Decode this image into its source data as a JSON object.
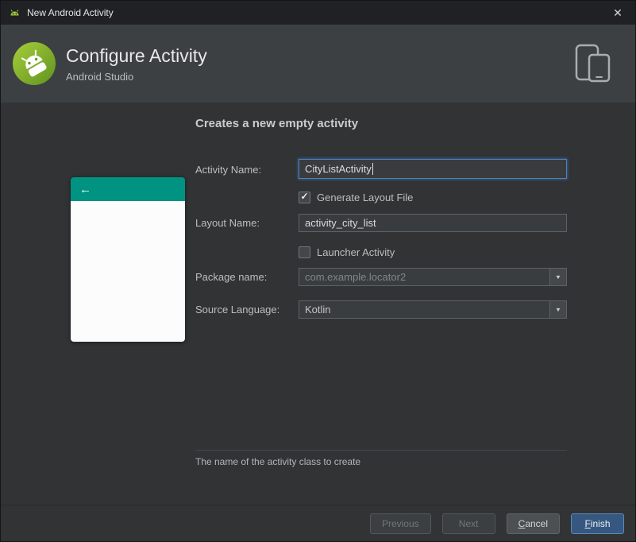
{
  "icons": {
    "check": "✓",
    "dropdown": "▼",
    "back_arrow": "←",
    "close": "✕"
  },
  "window": {
    "title": "New Android Activity"
  },
  "header": {
    "title": "Configure Activity",
    "subtitle": "Android Studio"
  },
  "content": {
    "heading": "Creates a new empty activity",
    "fields": {
      "activity_name": {
        "label": "Activity Name:",
        "value": "CityListActivity"
      },
      "generate_layout": {
        "label": "Generate Layout File",
        "checked": true
      },
      "layout_name": {
        "label": "Layout Name:",
        "value": "activity_city_list"
      },
      "launcher": {
        "label": "Launcher Activity",
        "checked": false
      },
      "package_name": {
        "label": "Package name:",
        "value": "com.example.locator2"
      },
      "source_language": {
        "label": "Source Language:",
        "value": "Kotlin"
      }
    },
    "help_text": "The name of the activity class to create"
  },
  "footer": {
    "previous": {
      "label": "Previous",
      "enabled": false
    },
    "next": {
      "label": "Next",
      "enabled": false
    },
    "cancel": {
      "mnemonic": "C",
      "rest": "ancel"
    },
    "finish": {
      "mnemonic": "F",
      "rest": "inish"
    }
  },
  "colors": {
    "preview_accent_teal": "#009381",
    "focus_blue": "#4f81bd",
    "primary_button_blue": "#365880",
    "header_bg": "#3d4043",
    "body_bg": "#313335"
  }
}
